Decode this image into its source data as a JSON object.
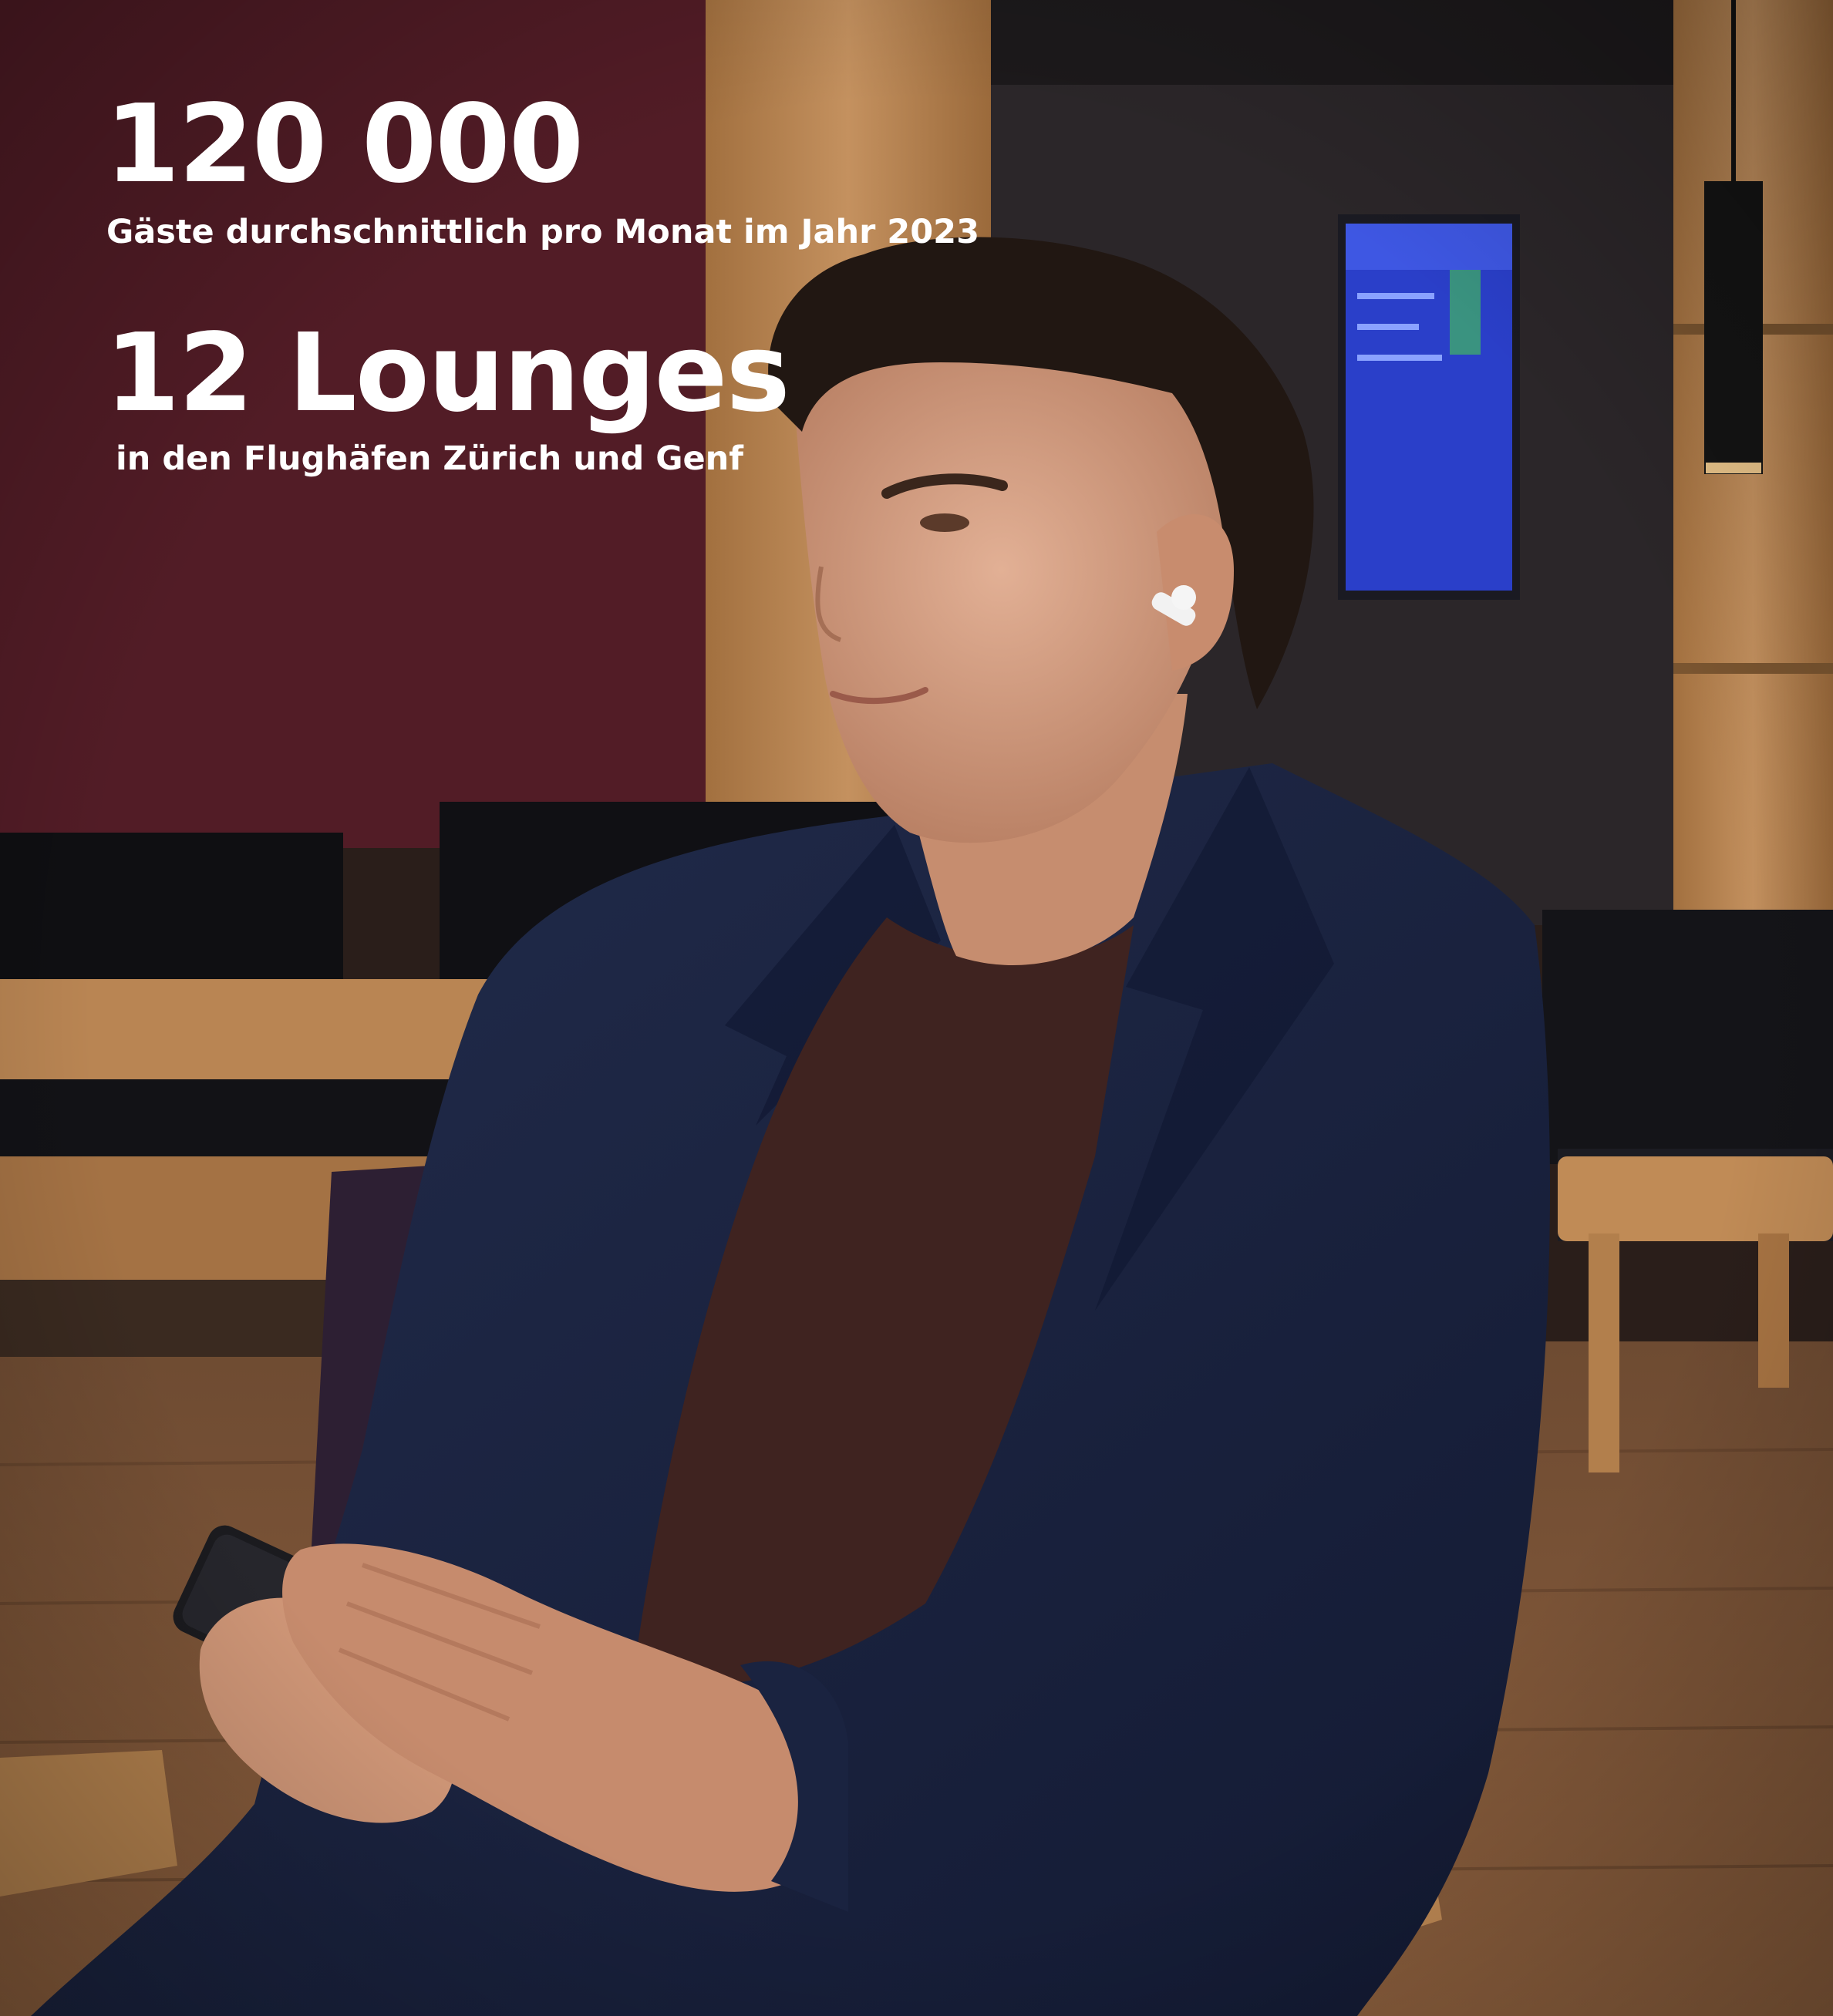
{
  "stats": [
    {
      "value": "120 000",
      "caption": "Gäste durchschnittlich pro Monat im Jahr 2023"
    },
    {
      "value": "12 Lounges",
      "caption": "in den Flughäfen Zürich und Genf"
    }
  ],
  "colors": {
    "wall_burgundy": "#521c26",
    "wall_dark": "#2b2629",
    "wood": "#b98553",
    "jacket_navy": "#1a2340",
    "shirt_brown": "#3f2320",
    "text": "#ffffff"
  }
}
